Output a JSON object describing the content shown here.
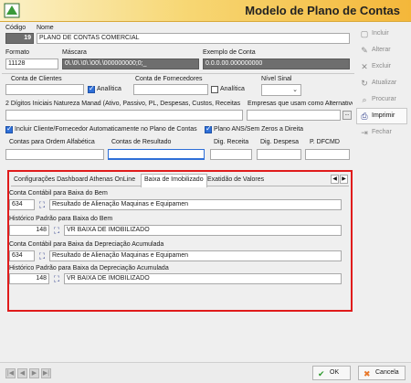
{
  "window": {
    "title": "Modelo de Plano de Contas"
  },
  "header": {
    "codigo_label": "Código",
    "codigo_value": "19",
    "nome_label": "Nome",
    "nome_value": "PLANO DE CONTAS COMERCIAL",
    "formato_label": "Formato",
    "formato_value": "11128",
    "mascara_label": "Máscara",
    "mascara_value": "0\\.\\0\\.\\0\\.\\00\\.\\000000000;0;_",
    "exemplo_label": "Exemplo de Conta",
    "exemplo_value": "0.0.0.00.000000000"
  },
  "accounts": {
    "clientes_label": "Conta de Clientes",
    "fornecedores_label": "Conta de Fornecedores",
    "nivel_label": "Nível Sinal",
    "analitica_label": "Analítica",
    "analitica2_label": "Analítica",
    "natureza_label": "2 Dígitos Iniciais Natureza Manad (Ativo, Passivo, PL, Despesas, Custos, Receitas",
    "empresas_label": "Empresas que usam como Alternativo",
    "empresas_btn": "..."
  },
  "options": {
    "incluir_label": "Incluir Cliente/Fornecedor Automaticamente no Plano de Contas",
    "plano_ans_label": "Plano ANS/Sem Zeros a Direita",
    "ordem_label": "Contas para Ordem  Alfabética",
    "resultado_label": "Contas de Resultado",
    "dig_receita_label": "Dig. Receita",
    "dig_despesa_label": "Dig. Despesa",
    "dfcmd_label": "P. DFCMD"
  },
  "sidebar": {
    "items": [
      {
        "label": "Incluir",
        "icon": "new-doc-icon"
      },
      {
        "label": "Alterar",
        "icon": "edit-icon"
      },
      {
        "label": "Excluir",
        "icon": "delete-icon"
      },
      {
        "label": "Atualizar",
        "icon": "refresh-icon"
      },
      {
        "label": "Procurar",
        "icon": "search-icon"
      },
      {
        "label": "Imprimir",
        "icon": "print-icon"
      },
      {
        "label": "Fechar",
        "icon": "close-icon"
      }
    ]
  },
  "tabs": [
    {
      "label": "Configurações Dashboard Athenas OnLine"
    },
    {
      "label": "Baixa de Imobilizado"
    },
    {
      "label": "Exatidão de Valores"
    }
  ],
  "imobilizado": {
    "conta_baixa_label": "Conta Contábil para Baixa do Bem",
    "conta_baixa_code": "634",
    "conta_baixa_desc": "Resultado de Alienação Maquinas e Equipamen",
    "hist_baixa_label": "Histórico Padrão para Baixa do Bem",
    "hist_baixa_code": "148",
    "hist_baixa_desc": "VR BAIXA DE IMOBILIZADO",
    "conta_dep_label": "Conta Contábil para Baixa da Depreciação Acumulada",
    "conta_dep_code": "634",
    "conta_dep_desc": "Resultado de Alienação Maquinas e Equipamen",
    "hist_dep_label": "Histórico Padrão para Baixa da Depreciação Acumulada",
    "hist_dep_code": "148",
    "hist_dep_desc": "VR BAIXA DE IMOBILIZADO"
  },
  "footer": {
    "nav": [
      "|◀",
      "◀",
      "▶",
      "▶|"
    ],
    "ok_label": "OK",
    "cancel_label": "Cancela"
  },
  "colors": {
    "accent": "#2e6fd8",
    "highlight": "#e01b1b",
    "title_gradient_end": "#f4b73a"
  }
}
